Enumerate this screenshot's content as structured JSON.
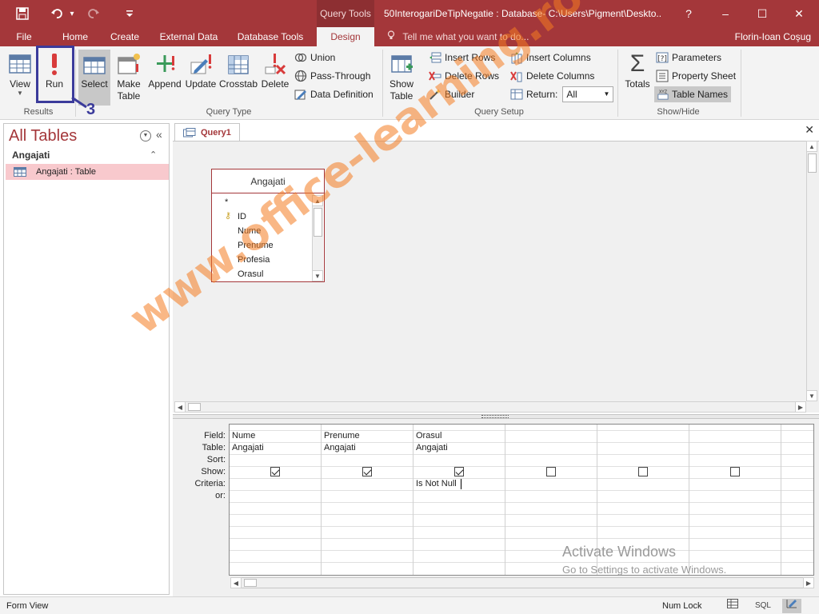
{
  "titlebar": {
    "context_tab": "Query Tools",
    "doc_title": "50InterogariDeTipNegatie : Database- C:\\Users\\Pigment\\Deskto...",
    "help": "?",
    "minimize": "–",
    "restore": "☐",
    "close": "✕",
    "qat_save": "💾",
    "qat_undo": "↶",
    "qat_dropdown": "▾",
    "qat_redo": "↷",
    "qat_customize": "⩡"
  },
  "tabs": {
    "file": "File",
    "home": "Home",
    "create": "Create",
    "external_data": "External Data",
    "database_tools": "Database Tools",
    "design": "Design",
    "tell_me": "Tell me what you want to do...",
    "user": "Florin-Ioan Coşug"
  },
  "ribbon": {
    "results": {
      "label": "Results",
      "view": "View",
      "run": "Run"
    },
    "query_type": {
      "label": "Query Type",
      "select": "Select",
      "make_table_1": "Make",
      "make_table_2": "Table",
      "append": "Append",
      "update": "Update",
      "crosstab": "Crosstab",
      "delete": "Delete",
      "union": "Union",
      "pass_through": "Pass-Through",
      "data_definition": "Data Definition"
    },
    "query_setup": {
      "label": "Query Setup",
      "show_table_1": "Show",
      "show_table_2": "Table",
      "insert_rows": "Insert Rows",
      "delete_rows": "Delete Rows",
      "builder": "Builder",
      "insert_columns": "Insert Columns",
      "delete_columns": "Delete Columns",
      "return_label": "Return:",
      "return_value": "All"
    },
    "show_hide": {
      "label": "Show/Hide",
      "totals": "Totals",
      "parameters": "Parameters",
      "property_sheet": "Property Sheet",
      "table_names": "Table Names"
    }
  },
  "navpane": {
    "title": "All Tables",
    "group": "Angajati",
    "item": "Angajati : Table"
  },
  "document": {
    "tab": "Query1",
    "close": "✕"
  },
  "table_box": {
    "title": "Angajati",
    "fields": [
      "*",
      "ID",
      "Nume",
      "Prenume",
      "Profesia",
      "Orasul"
    ]
  },
  "qbe": {
    "row_labels": [
      "Field:",
      "Table:",
      "Sort:",
      "Show:",
      "Criteria:",
      "or:"
    ],
    "columns": [
      {
        "field": "Nume",
        "table": "Angajati",
        "show": true,
        "criteria": ""
      },
      {
        "field": "Prenume",
        "table": "Angajati",
        "show": true,
        "criteria": ""
      },
      {
        "field": "Orasul",
        "table": "Angajati",
        "show": true,
        "criteria": "Is Not Null"
      },
      {
        "field": "",
        "table": "",
        "show": false,
        "criteria": ""
      },
      {
        "field": "",
        "table": "",
        "show": false,
        "criteria": ""
      },
      {
        "field": "",
        "table": "",
        "show": false,
        "criteria": ""
      }
    ]
  },
  "status": {
    "mode": "Form View",
    "num_lock": "Num Lock",
    "sql": "SQL"
  },
  "overlays": {
    "watermark": "www.office-learning.ro",
    "activate_title": "Activate Windows",
    "activate_sub": "Go to Settings to activate Windows.",
    "step_number": "3"
  },
  "colors": {
    "accent": "#a4373a",
    "nav_selected": "#f8c9cd",
    "watermark": "#f47c20",
    "annotation": "#3b3b9b"
  }
}
